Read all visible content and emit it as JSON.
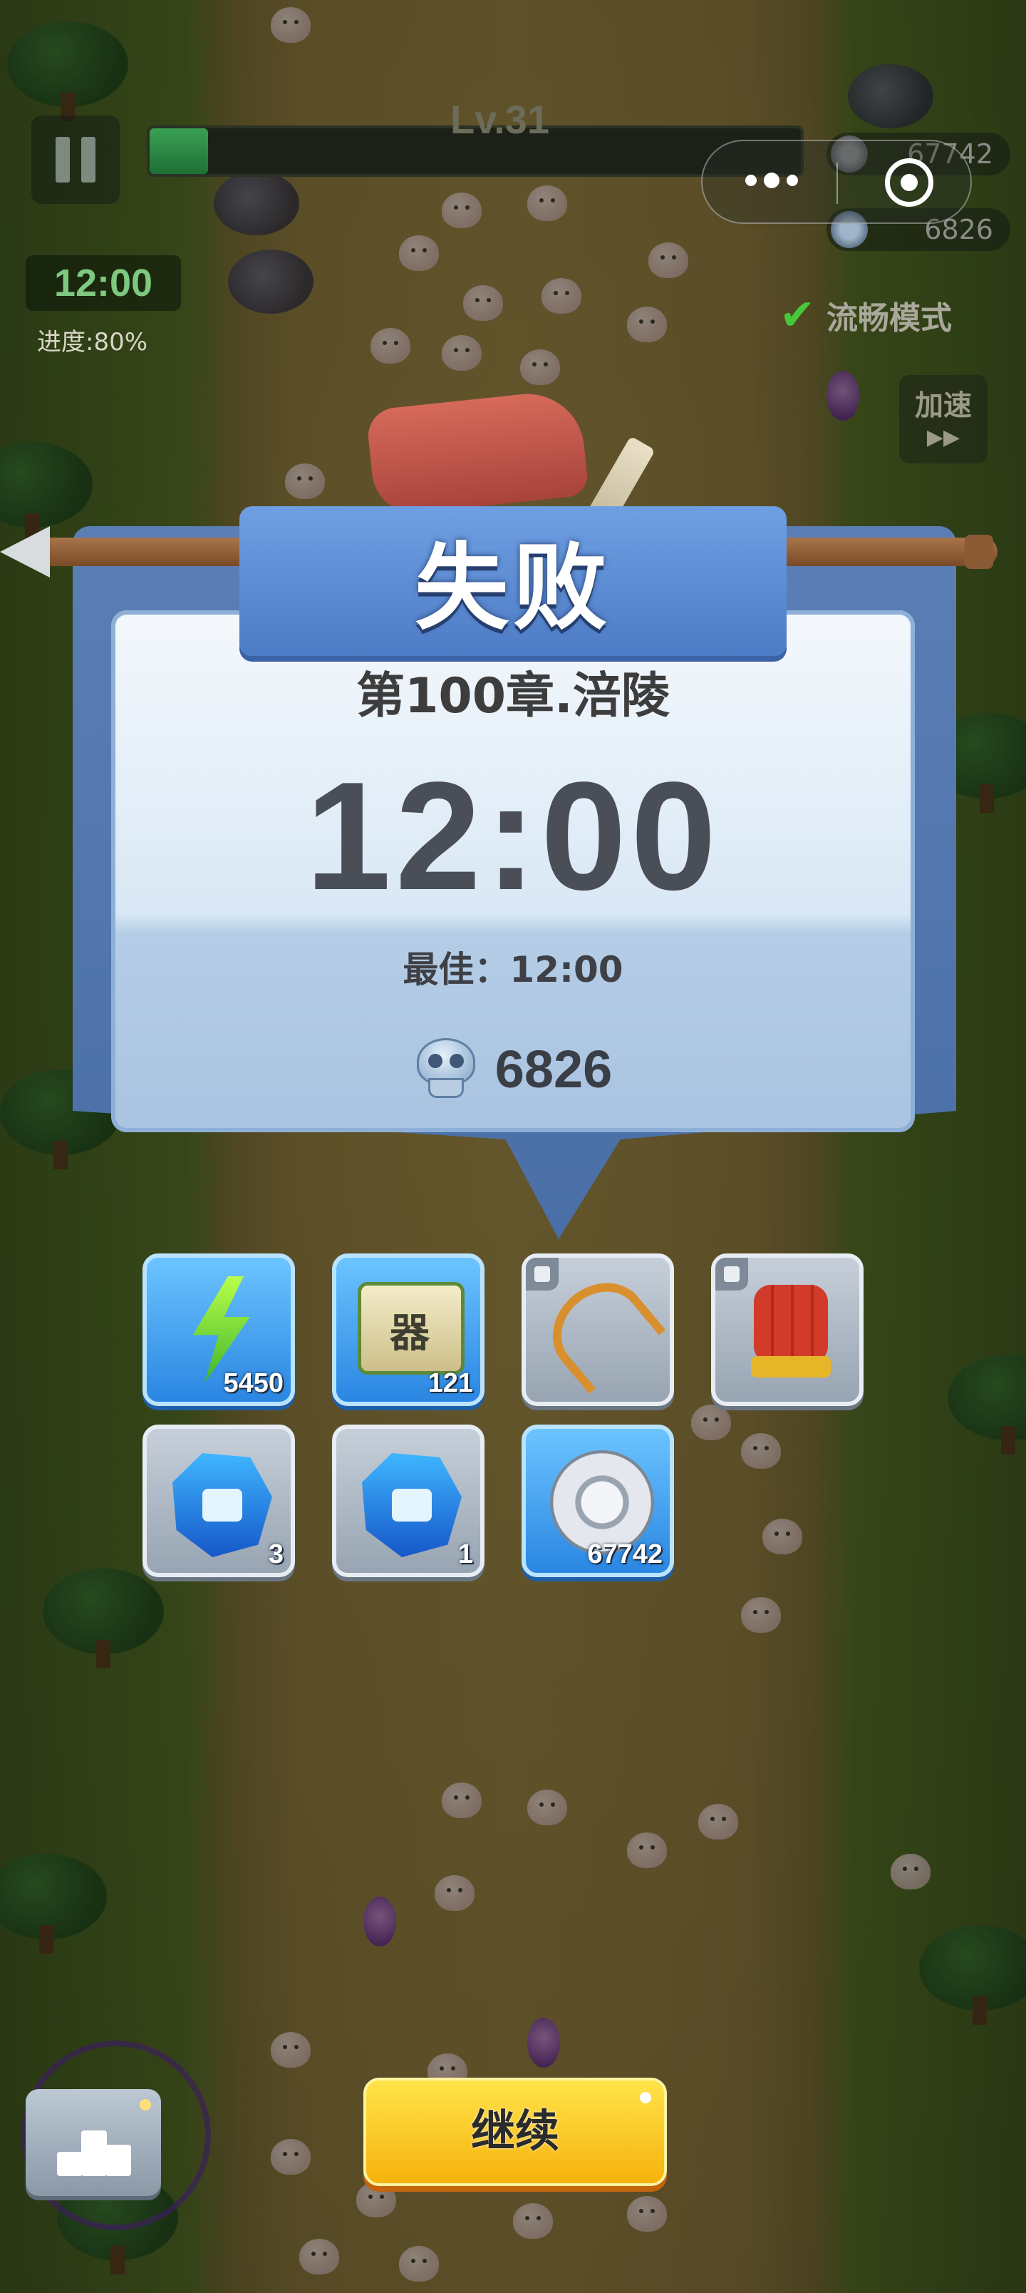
{
  "hud": {
    "level": "Lv.31",
    "xp_fraction": 0.09,
    "timer": "12:00",
    "progress": "进度:80%",
    "coins": "67742",
    "kills": "6826",
    "smooth_mode": "流畅模式",
    "speed_label": "加速",
    "speed_arrows": "▶▶"
  },
  "result": {
    "title": "失败",
    "chapter": "第100章.涪陵",
    "time": "12:00",
    "best": "最佳：12:00",
    "kills": "6826"
  },
  "rewards": [
    {
      "item": "energy-bolt",
      "qty": "5450"
    },
    {
      "item": "map-scroll",
      "qty": "121"
    },
    {
      "item": "crossbow",
      "qty": ""
    },
    {
      "item": "red-gauntlet",
      "qty": ""
    },
    {
      "item": "boot-gem",
      "qty": "3"
    },
    {
      "item": "helmet-gem",
      "qty": "1"
    },
    {
      "item": "silver-coin",
      "qty": "67742"
    }
  ],
  "buttons": {
    "continue": "继续"
  },
  "colors": {
    "continue_button": "#f6b20c",
    "ribbon": "#4d7cc6",
    "xp_fill": "#3aa055"
  }
}
